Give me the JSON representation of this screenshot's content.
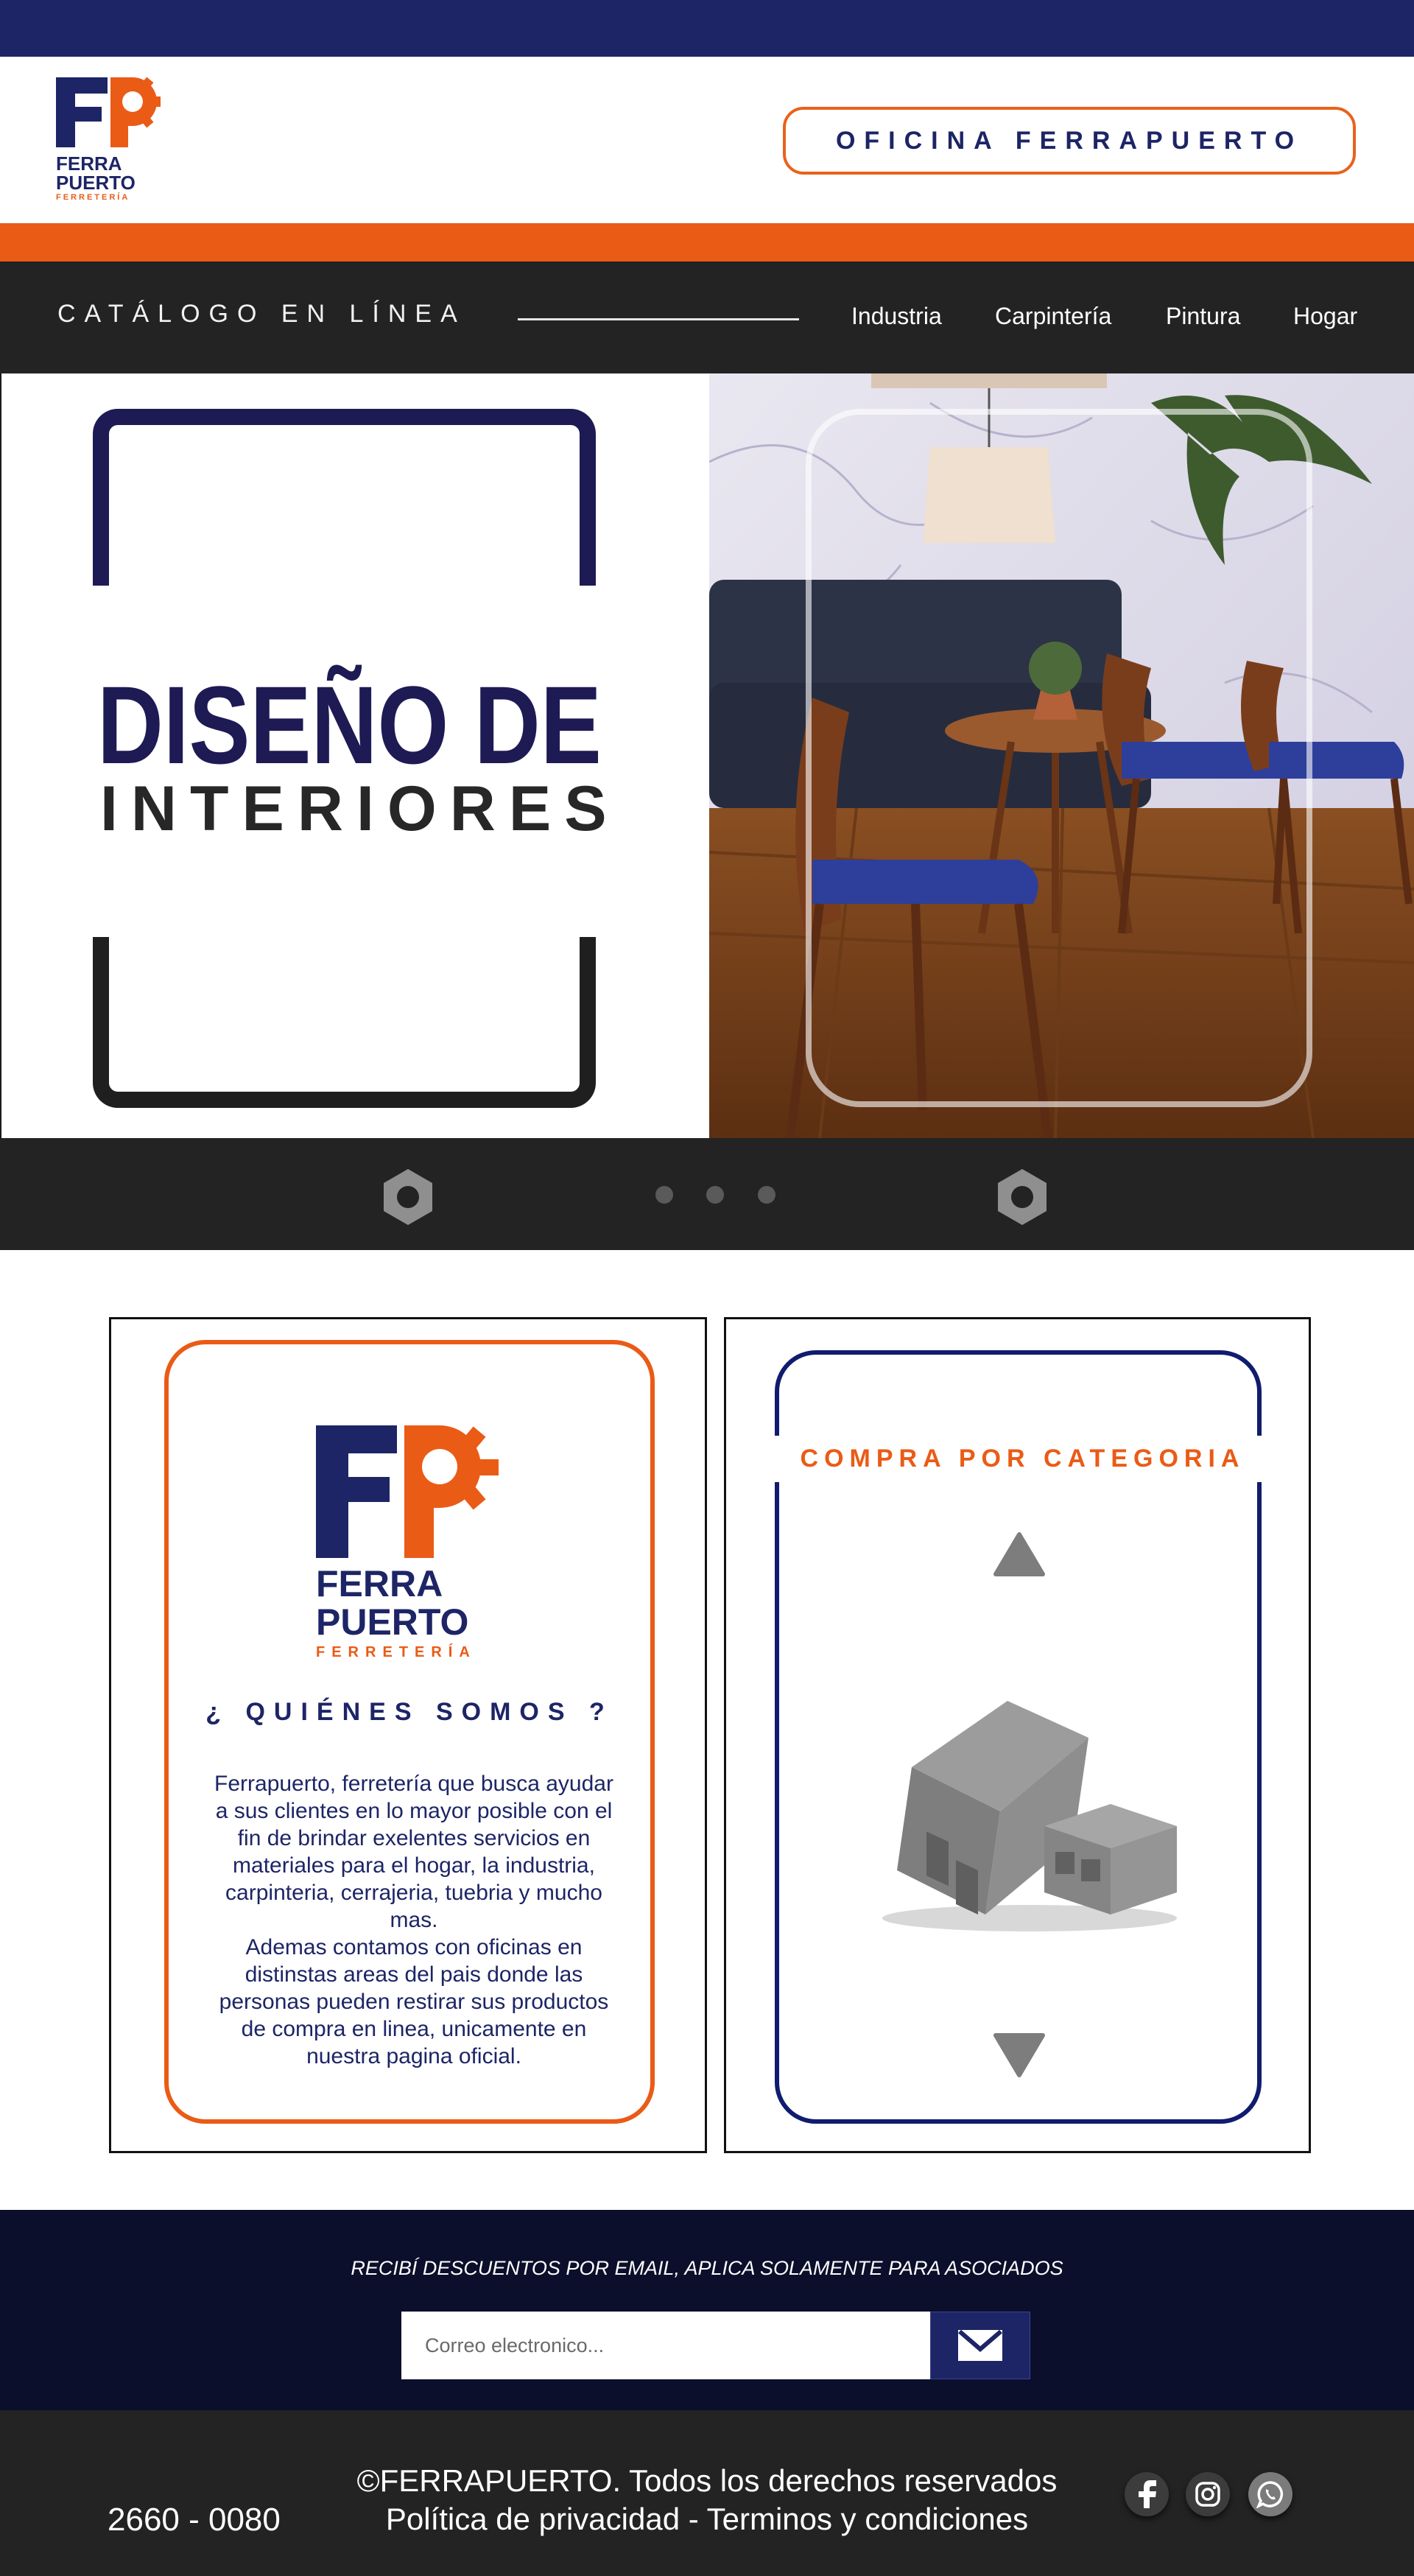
{
  "brand": {
    "line1": "FERRA",
    "line2": "PUERTO",
    "tagline": "FERRETERÍA",
    "colors": {
      "navy": "#1d2566",
      "orange": "#ea5b16",
      "dark": "#232323"
    }
  },
  "header": {
    "office_button": "OFICINA FERRAPUERTO"
  },
  "nav": {
    "title": "CATÁLOGO EN LÍNEA",
    "links": [
      "Industria",
      "Carpintería",
      "Pintura",
      "Hogar"
    ]
  },
  "hero": {
    "title": "DISEÑO DE",
    "subtitle": "INTERIORES"
  },
  "slider": {
    "prev_icon": "hex-nut-icon",
    "next_icon": "hex-nut-icon",
    "dots": 3
  },
  "about": {
    "title": "¿ QUIÉNES SOMOS ?",
    "text": "Ferrapuerto, ferretería que busca ayudar a sus clientes en lo mayor posible con el fin de brindar exelentes servicios en materiales para el hogar, la industria, carpinteria, cerrajeria, tuebria y mucho mas. Ademas contamos con oficinas en distinstas areas del pais donde las personas pueden restirar sus productos de compra en linea, unicamente en nuestra pagina oficial.",
    "text_lines": [
      "Ferrapuerto, ferretería que busca ayudar",
      "a sus clientes en lo mayor posible con el",
      "fin de brindar exelentes servicios en",
      "materiales para el hogar, la industria,",
      "carpinteria, cerrajeria, tuebria y mucho",
      "mas.",
      "Ademas contamos con oficinas en",
      "distinstas areas del pais donde las",
      "personas pueden restirar sus productos",
      "de compra en linea, unicamente en",
      "nuestra pagina oficial."
    ]
  },
  "category": {
    "title": "COMPRA POR CATEGORIA",
    "up_icon": "triangle-up-icon",
    "down_icon": "triangle-down-icon"
  },
  "newsletter": {
    "text": "RECIBÍ DESCUENTOS POR EMAIL, APLICA SOLAMENTE PARA ASOCIADOS",
    "placeholder": "Correo electronico...",
    "send_icon": "envelope-icon"
  },
  "footer": {
    "phone": "2660 - 0080",
    "copyright": "©FERRAPUERTO. Todos los derechos reservados",
    "legal": "Política de privacidad - Terminos y condiciones",
    "social": [
      "facebook-icon",
      "instagram-icon",
      "whatsapp-icon"
    ]
  }
}
